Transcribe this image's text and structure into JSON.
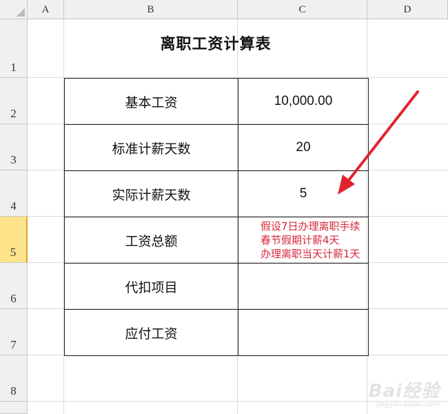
{
  "columns": [
    "A",
    "B",
    "C",
    "D"
  ],
  "rows": [
    "1",
    "2",
    "3",
    "4",
    "5",
    "6",
    "7",
    "8"
  ],
  "title": "离职工资计算表",
  "table": [
    {
      "label": "基本工资",
      "value": "10,000.00"
    },
    {
      "label": "标准计薪天数",
      "value": "20"
    },
    {
      "label": "实际计薪天数",
      "value": "5"
    },
    {
      "label": "工资总额",
      "value": ""
    },
    {
      "label": "代扣项目",
      "value": ""
    },
    {
      "label": "应付工资",
      "value": ""
    }
  ],
  "note": [
    "假设7日办理离职手续",
    "春节假期计薪4天",
    "办理离职当天计薪1天"
  ],
  "watermark": {
    "brand": "Bai经验",
    "url": "jingyan.baidu.com"
  },
  "colors": {
    "note": "#d8283b",
    "selected_row": "#fde38a",
    "header_bg": "#f0f0f0"
  }
}
